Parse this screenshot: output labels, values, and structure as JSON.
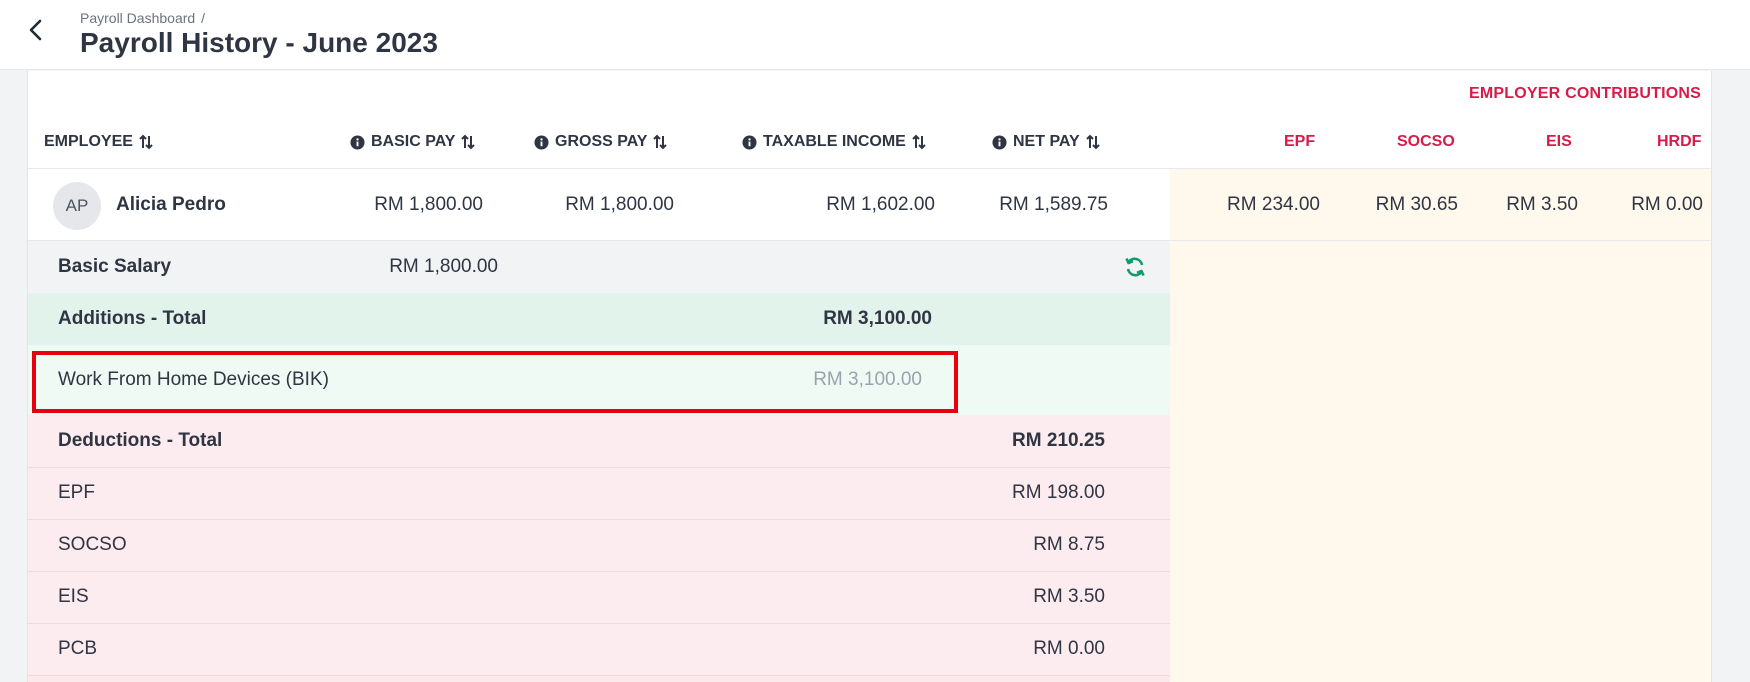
{
  "header": {
    "breadcrumb": "Payroll Dashboard",
    "breadcrumb_sep": "/",
    "title": "Payroll History - June 2023"
  },
  "employer_contributions_title": "EMPLOYER CONTRIBUTIONS",
  "columns": {
    "employee": "EMPLOYEE",
    "basic_pay": "BASIC PAY",
    "gross_pay": "GROSS PAY",
    "taxable_income": "TAXABLE INCOME",
    "net_pay": "NET PAY",
    "epf": "EPF",
    "socso": "SOCSO",
    "eis": "EIS",
    "hrdf": "HRDF"
  },
  "employee": {
    "initials": "AP",
    "name": "Alicia Pedro",
    "basic_pay": "RM 1,800.00",
    "gross_pay": "RM 1,800.00",
    "taxable_income": "RM 1,602.00",
    "net_pay": "RM 1,589.75",
    "epf": "RM 234.00",
    "socso": "RM 30.65",
    "eis": "RM 3.50",
    "hrdf": "RM 0.00"
  },
  "breakdown": {
    "basic_salary": {
      "label": "Basic Salary",
      "value": "RM 1,800.00"
    },
    "additions_total": {
      "label": "Additions - Total",
      "value": "RM 3,100.00"
    },
    "wfh": {
      "label": "Work From Home Devices (BIK)",
      "value": "RM 3,100.00"
    },
    "deductions_total": {
      "label": "Deductions - Total",
      "value": "RM 210.25"
    },
    "deductions": [
      {
        "label": "EPF",
        "value": "RM 198.00"
      },
      {
        "label": "SOCSO",
        "value": "RM 8.75"
      },
      {
        "label": "EIS",
        "value": "RM 3.50"
      },
      {
        "label": "PCB",
        "value": "RM 0.00"
      }
    ]
  },
  "colors": {
    "accent_red": "#d81b49",
    "highlight": "#e8000b",
    "refresh_green": "#0f9d6b"
  },
  "icons": [
    "back-arrow-icon",
    "info-icon",
    "sort-icon",
    "refresh-icon"
  ]
}
